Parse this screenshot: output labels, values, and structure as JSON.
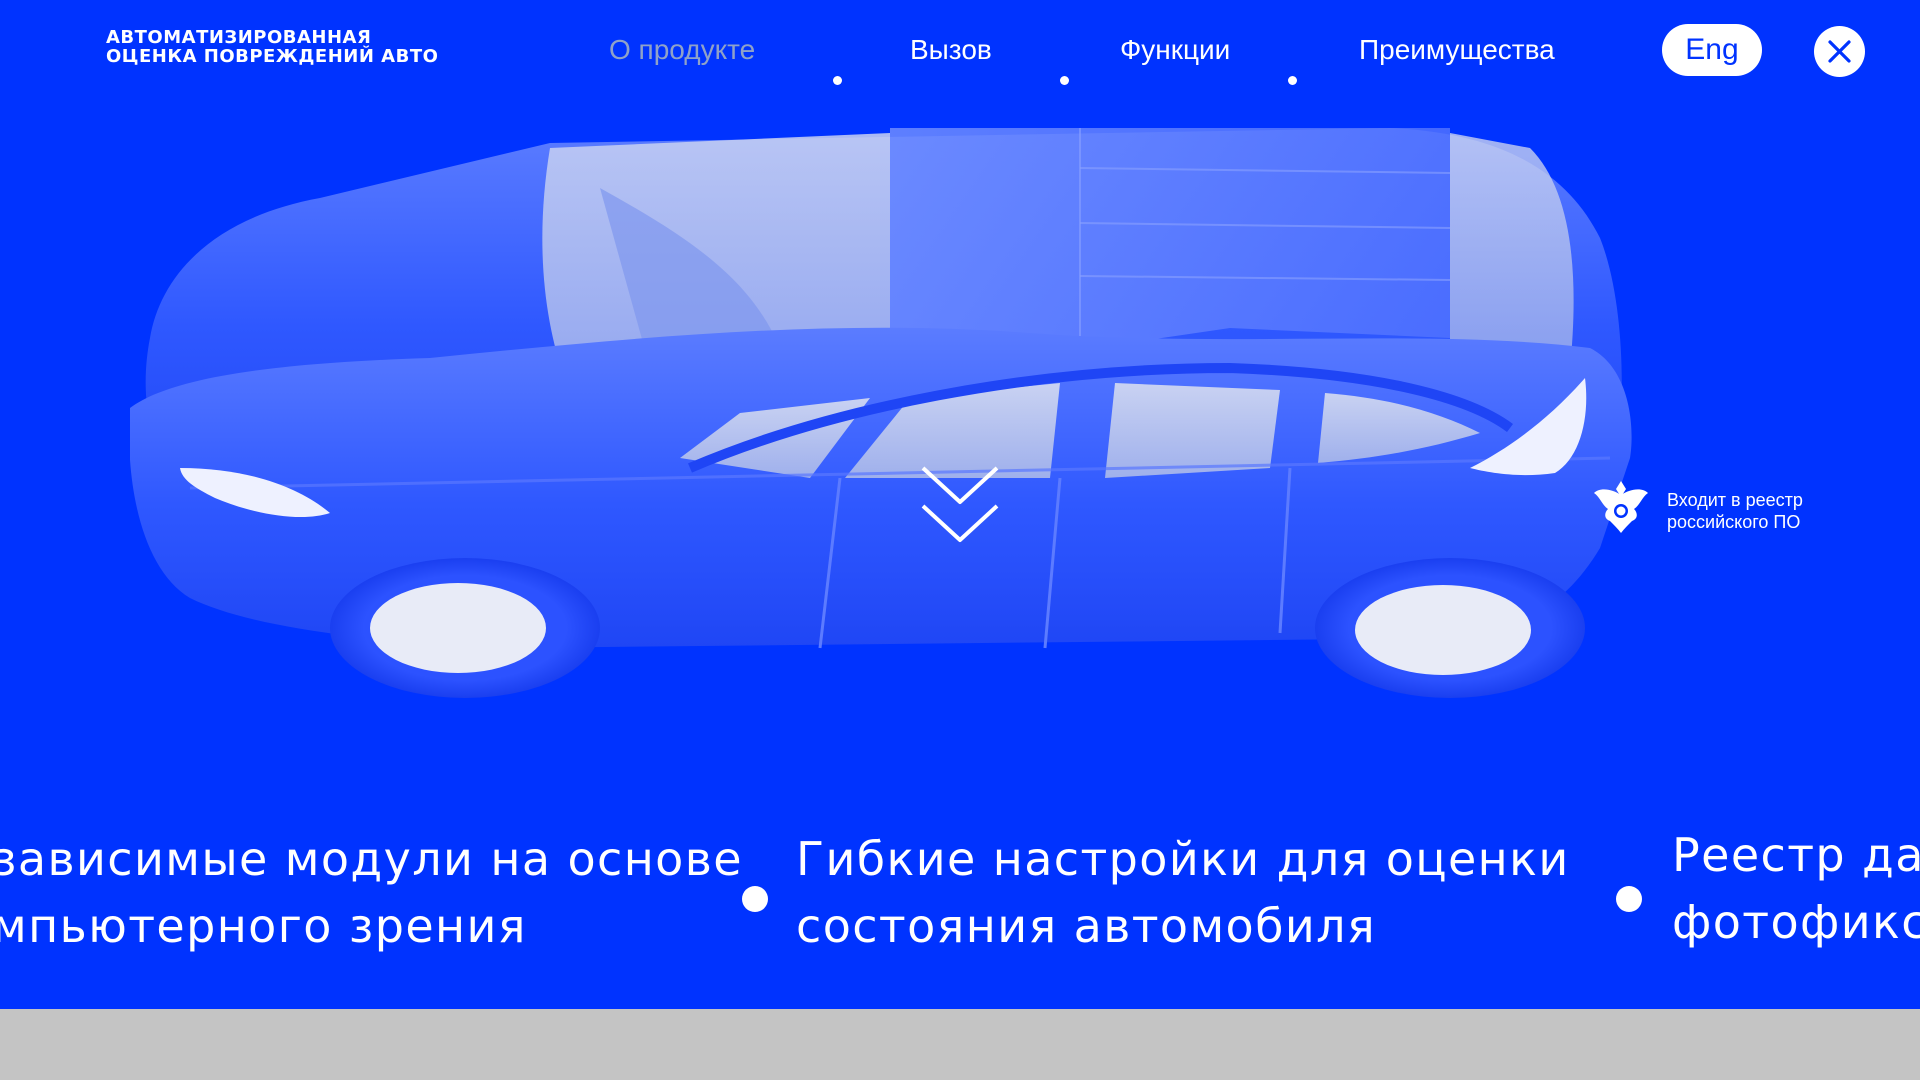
{
  "logo": {
    "line1": "АВТОМАТИЗИРОВАННАЯ",
    "line2": "ОЦЕНКА ПОВРЕЖДЕНИЙ АВТО"
  },
  "nav": {
    "items": [
      {
        "label": "О продукте",
        "active": true
      },
      {
        "label": "Вызов",
        "active": false
      },
      {
        "label": "Функции",
        "active": false
      },
      {
        "label": "Преимущества",
        "active": false
      }
    ]
  },
  "header": {
    "lang_label": "Eng",
    "close_icon": "close-icon"
  },
  "hero": {
    "scroll_icon": "chevron-double-down-icon",
    "registry": {
      "icon": "russian-coat-of-arms-icon",
      "line1": "Входит в реестр",
      "line2": "российского ПО"
    }
  },
  "features": [
    {
      "line1": "зависимые модули на основе",
      "line2": "мпьютерного зрения"
    },
    {
      "line1": "Гибкие настройки для оценки",
      "line2": "состояния автомобиля"
    },
    {
      "line1": "Реестр да",
      "line2": "фотофикса"
    }
  ],
  "colors": {
    "background": "#0033ff",
    "text": "#ffffff",
    "nav_active": "#8fa2c8",
    "footer_strip": "#c4c4c4"
  }
}
